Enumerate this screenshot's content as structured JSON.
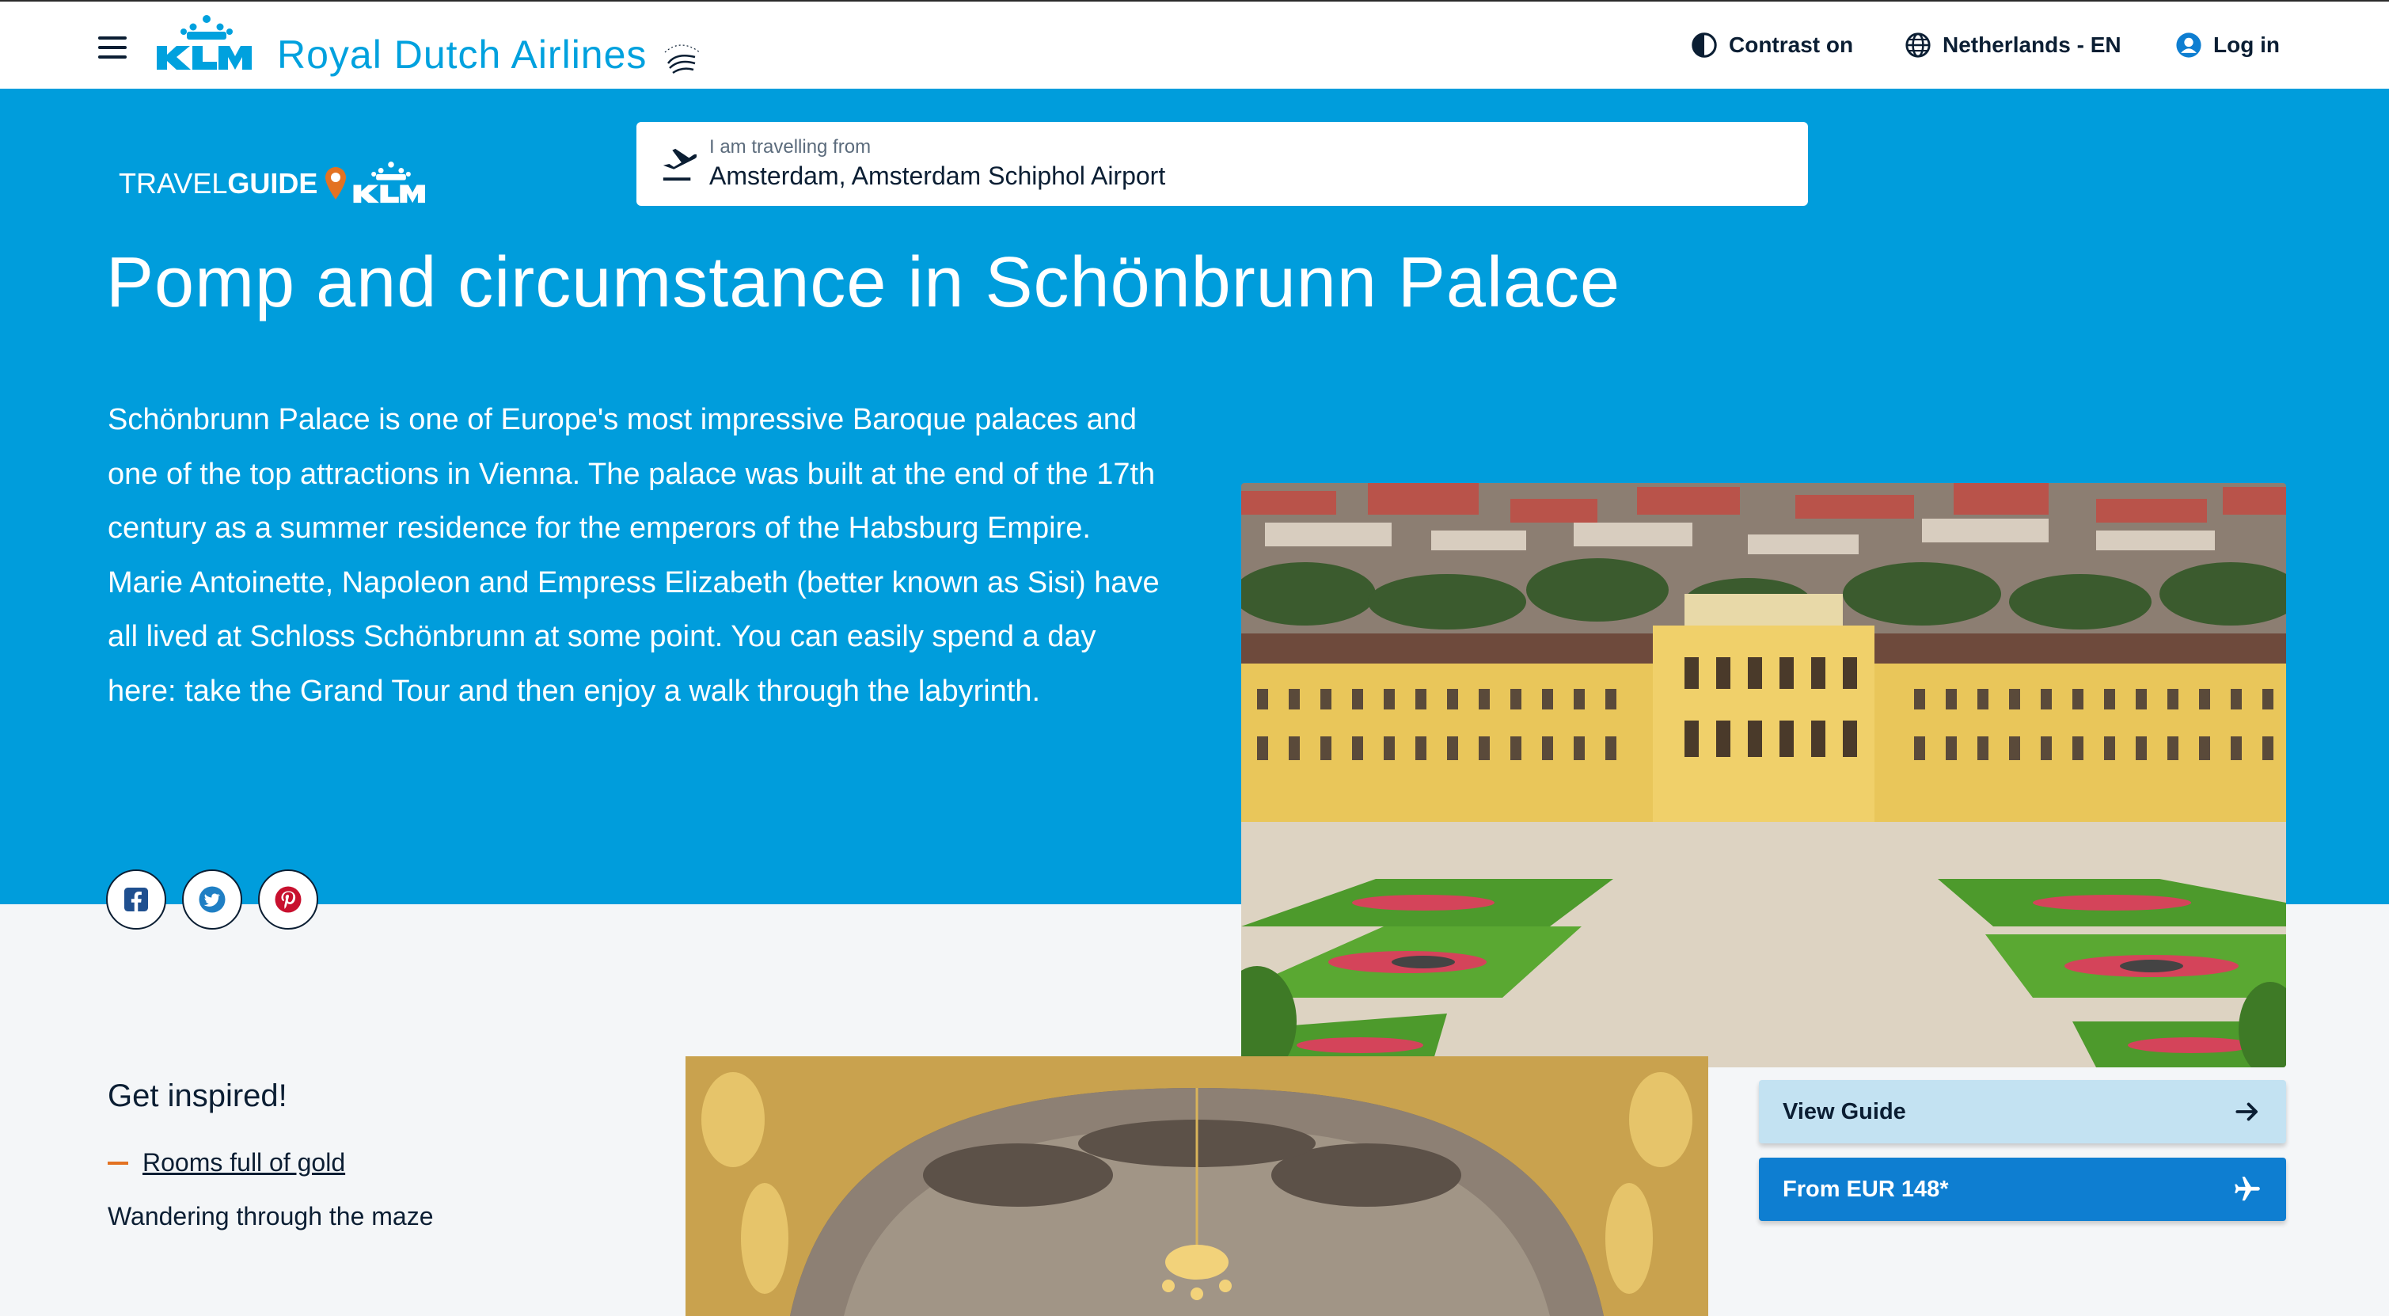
{
  "header": {
    "brand": "Royal Dutch Airlines",
    "contrast_label": "Contrast on",
    "region_label": "Netherlands - EN",
    "login_label": "Log in"
  },
  "travelguide": {
    "label_light": "TRAVEL",
    "label_bold": "GUIDE"
  },
  "search": {
    "label": "I am travelling from",
    "value": "Amsterdam, Amsterdam Schiphol Airport"
  },
  "article": {
    "title": "Pomp and circumstance in Schönbrunn Palace",
    "intro": "Schönbrunn Palace is one of Europe's most impressive Baroque palaces and one of the top attractions in Vienna. The palace was built at the end of the 17th century as a summer residence for the emperors of the Habsburg Empire. Marie Antoinette, Napoleon and Empress Elizabeth (better known as Sisi) have all lived at Schloss Schönbrunn at some point. You can easily spend a day here: take the Grand Tour and then enjoy a walk through the labyrinth."
  },
  "share": [
    "facebook-icon",
    "twitter-icon",
    "pinterest-icon"
  ],
  "inspire": {
    "title": "Get inspired!",
    "items": [
      "Rooms full of gold",
      "Wandering through the maze"
    ]
  },
  "actions": {
    "view_guide": "View Guide",
    "fare": "From EUR 148*"
  },
  "colors": {
    "hero_blue": "#009ddc",
    "brand_blue": "#00a1de",
    "button_blue": "#0e7ed1",
    "button_light": "#c3e2f2",
    "accent_orange": "#e37222",
    "page_bg": "#f4f6f8"
  }
}
